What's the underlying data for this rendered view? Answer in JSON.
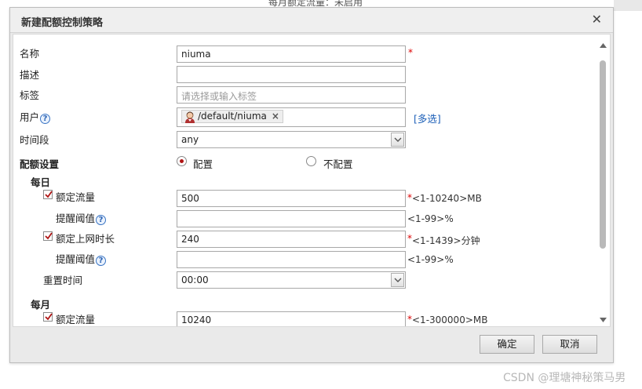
{
  "background": {
    "top_text": "每月额定流量：未启用",
    "watermark": "CSDN @理塘神秘策马男"
  },
  "dialog": {
    "title": "新建配额控制策略",
    "close_icon": "close-icon",
    "fields": {
      "name": {
        "label": "名称",
        "value": "niuma",
        "required": "*"
      },
      "description": {
        "label": "描述",
        "value": ""
      },
      "tags": {
        "label": "标签",
        "placeholder": "请选择或输入标签"
      },
      "user": {
        "label": "用户",
        "tag": "/default/niuma",
        "tag_remove": "×",
        "multi_select": "[多选]"
      },
      "time_period": {
        "label": "时间段",
        "value": "any"
      }
    },
    "quota": {
      "label": "配额设置",
      "options": [
        "配置",
        "不配置"
      ],
      "selected": "配置",
      "daily": {
        "title": "每日",
        "traffic": {
          "label": "额定流量",
          "checked": true,
          "value": "500",
          "required": "*",
          "hint": "<1-10240>MB"
        },
        "traffic_alert": {
          "label": "提醒阈值",
          "value": "",
          "hint": "<1-99>%"
        },
        "online_time": {
          "label": "额定上网时长",
          "checked": true,
          "value": "240",
          "required": "*",
          "hint": "<1-1439>分钟"
        },
        "time_alert": {
          "label": "提醒阈值",
          "value": "",
          "hint": "<1-99>%"
        },
        "reset_time": {
          "label": "重置时间",
          "value": "00:00"
        }
      },
      "monthly": {
        "title": "每月",
        "traffic": {
          "label": "额定流量",
          "checked": true,
          "value": "10240",
          "required": "*",
          "hint": "<1-300000>MB"
        }
      }
    },
    "buttons": {
      "ok": "确定",
      "cancel": "取消"
    }
  },
  "colors": {
    "required": "#d00000",
    "link": "#1c5fb8",
    "radio_selected": "#b01515"
  }
}
